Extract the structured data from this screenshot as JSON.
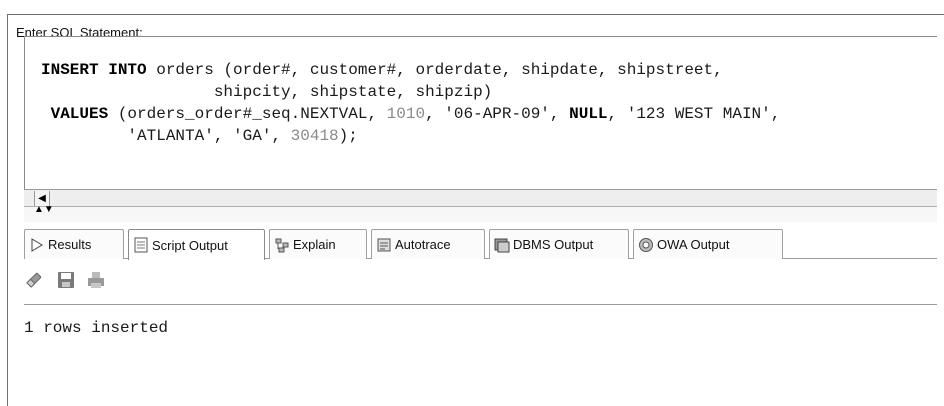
{
  "editor": {
    "label": "Enter SQL Statement:",
    "lines": [
      [
        {
          "t": "INSERT INTO",
          "c": "kw"
        },
        {
          "t": " orders (order#, customer#, orderdate, shipdate, shipstreet,"
        }
      ],
      [
        {
          "t": "                  shipcity, shipstate, shipzip)"
        }
      ],
      [
        {
          "t": " VALUES",
          "c": "kw"
        },
        {
          "t": " (orders_order#_seq.NEXTVAL, "
        },
        {
          "t": "1010",
          "c": "num"
        },
        {
          "t": ", '06-APR-09', "
        },
        {
          "t": "NULL",
          "c": "kw"
        },
        {
          "t": ", '123 WEST MAIN',"
        }
      ],
      [
        {
          "t": "         'ATLANTA', 'GA', "
        },
        {
          "t": "30418",
          "c": "num"
        },
        {
          "t": ");"
        }
      ]
    ]
  },
  "tabs": [
    {
      "label": "Results",
      "icon": "play-icon"
    },
    {
      "label": "Script Output",
      "icon": "script-icon",
      "active": true
    },
    {
      "label": "Explain",
      "icon": "explain-icon"
    },
    {
      "label": "Autotrace",
      "icon": "autotrace-icon"
    },
    {
      "label": "DBMS Output",
      "icon": "dbms-icon"
    },
    {
      "label": "OWA Output",
      "icon": "owa-icon"
    }
  ],
  "toolbar": {
    "items": [
      "eraser-icon",
      "save-icon",
      "print-icon"
    ]
  },
  "output": {
    "text": "1 rows inserted"
  }
}
